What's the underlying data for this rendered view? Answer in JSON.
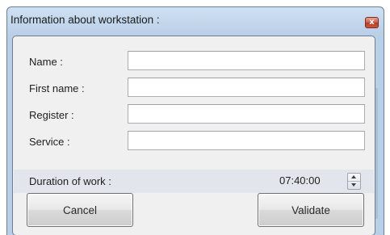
{
  "window": {
    "title": "Information about workstation :",
    "close_glyph": "x"
  },
  "form": {
    "fields": [
      {
        "label": "Name :",
        "value": ""
      },
      {
        "label": "First name :",
        "value": ""
      },
      {
        "label": "Register :",
        "value": ""
      },
      {
        "label": "Service :",
        "value": ""
      }
    ],
    "duration": {
      "label": "Duration of work :",
      "value": "07:40:00"
    }
  },
  "buttons": {
    "cancel_label": "Cancel",
    "validate_label": "Validate"
  },
  "icons": {
    "close": "close-icon",
    "spin_up": "arrow-up-icon",
    "spin_down": "arrow-down-icon"
  },
  "colors": {
    "frame": "#b9cfe7",
    "close_button": "#d35a3d",
    "panel": "#f0f0f0",
    "duration_row": "#e2e6ec"
  }
}
